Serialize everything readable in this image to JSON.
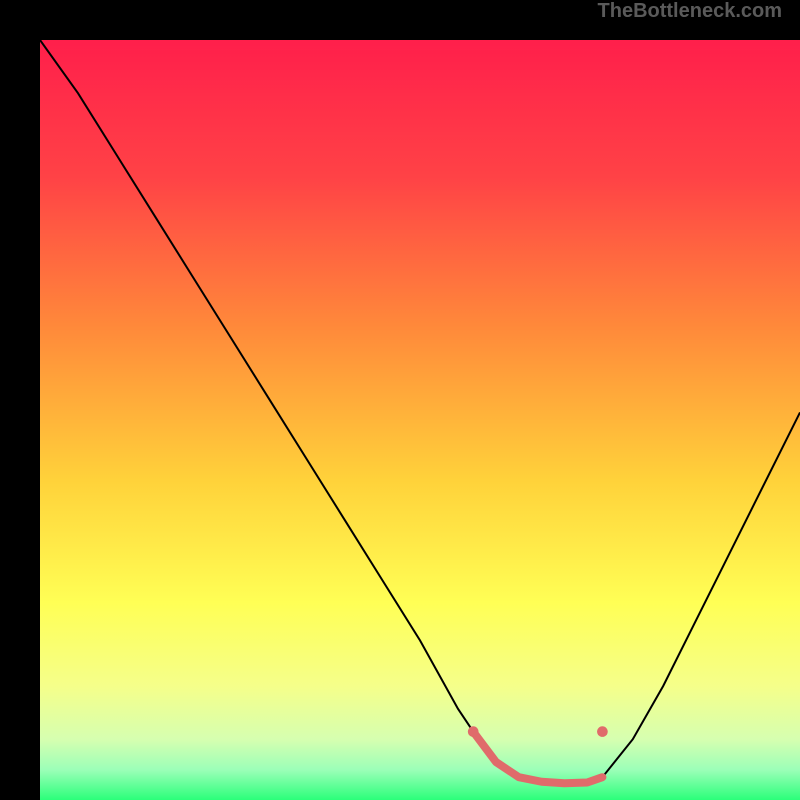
{
  "watermark": "TheBottleneck.com",
  "chart_data": {
    "type": "line",
    "title": "",
    "xlabel": "",
    "ylabel": "",
    "xlim": [
      0,
      100
    ],
    "ylim": [
      0,
      100
    ],
    "gradient_stops": [
      {
        "offset": 0,
        "color": "#ff1f4b"
      },
      {
        "offset": 18,
        "color": "#ff4246"
      },
      {
        "offset": 38,
        "color": "#ff8a3a"
      },
      {
        "offset": 58,
        "color": "#ffd23a"
      },
      {
        "offset": 74,
        "color": "#ffff55"
      },
      {
        "offset": 85,
        "color": "#f5ff8a"
      },
      {
        "offset": 92,
        "color": "#d6ffb0"
      },
      {
        "offset": 96,
        "color": "#9cffb8"
      },
      {
        "offset": 100,
        "color": "#2bff7a"
      }
    ],
    "series": [
      {
        "name": "bottleneck-curve",
        "x": [
          0,
          5,
          10,
          15,
          20,
          25,
          30,
          35,
          40,
          45,
          50,
          55,
          57,
          60,
          63,
          66,
          69,
          72,
          74,
          78,
          82,
          86,
          90,
          94,
          98,
          100
        ],
        "y": [
          100,
          93,
          85,
          77,
          69,
          61,
          53,
          45,
          37,
          29,
          21,
          12,
          9,
          5,
          3,
          2.4,
          2.2,
          2.3,
          3,
          8,
          15,
          23,
          31,
          39,
          47,
          51
        ]
      }
    ],
    "markers": [
      {
        "name": "optimal-start",
        "x": 57,
        "y": 9,
        "color": "#e06b6b",
        "r": 5
      },
      {
        "name": "optimal-end",
        "x": 74,
        "y": 9,
        "color": "#e06b6b",
        "r": 5
      }
    ],
    "optimal_band": {
      "x": [
        57,
        60,
        63,
        66,
        69,
        72,
        74
      ],
      "y": [
        9,
        5,
        3,
        2.4,
        2.2,
        2.3,
        3
      ],
      "color": "#e06b6b",
      "width": 8
    }
  }
}
